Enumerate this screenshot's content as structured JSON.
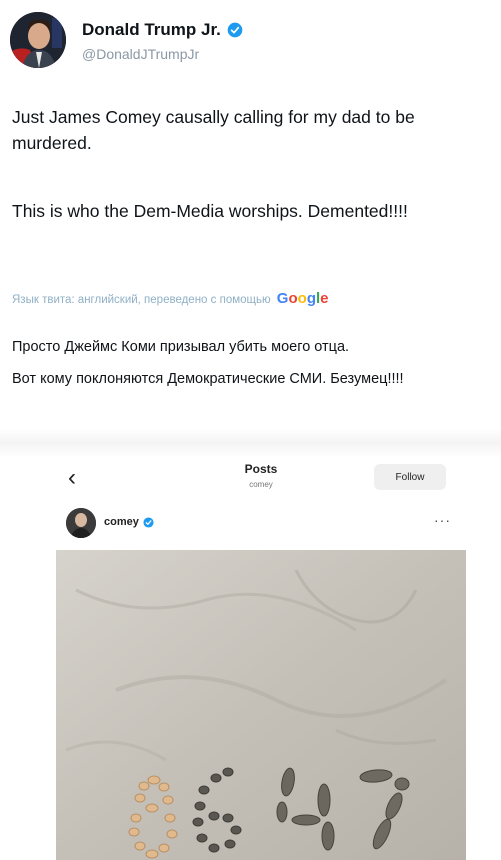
{
  "author": {
    "name": "Donald Trump Jr.",
    "handle": "@DonaldJTrumpJr"
  },
  "tweet": {
    "line1": "Just James Comey causally calling for my dad to be murdered.",
    "line2": "This is who the Dem-Media worships. Demented!!!!"
  },
  "translation": {
    "note": "Язык твита: английский, переведено с помощью",
    "provider_letters": [
      "G",
      "o",
      "o",
      "g",
      "l",
      "e"
    ],
    "line1": "Просто Джеймс Коми призывал убить моего отца.",
    "line2": "Вот кому поклоняются Демократические СМИ. Безумец!!!!"
  },
  "embed": {
    "title": "Posts",
    "subtitle": "comey",
    "follow_label": "Follow",
    "username": "comey",
    "more_label": "···"
  },
  "colors": {
    "verified": "#1d9bf0",
    "translate_note": "#8fb0c6"
  }
}
